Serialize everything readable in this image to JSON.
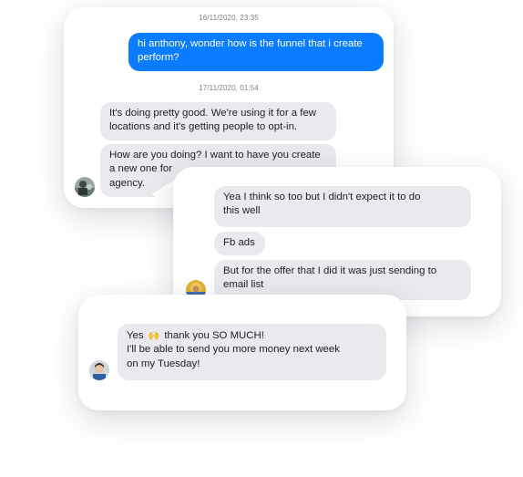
{
  "conversation_1": {
    "timestamp_1": "16/11/2020, 23:35",
    "outgoing": {
      "line1": "hi anthony, wonder how is the funnel that i create",
      "line2": "perform?"
    },
    "timestamp_2": "17/11/2020, 01:54",
    "reply_1": {
      "line1": "It's doing pretty good. We're using it for a few",
      "line2": "locations and it's getting people to opt-in."
    },
    "reply_2": {
      "line1": "How are you doing? I want to have you create",
      "line2": "a new one for",
      "line3": "agency."
    }
  },
  "conversation_2": {
    "msg_1": {
      "line1": "Yea I think so too but I didn't expect it to do",
      "line2": "this well"
    },
    "msg_2": "Fb ads",
    "msg_3": {
      "line1": "But for the offer that I did it was just sending to",
      "line2": "email list"
    }
  },
  "conversation_3": {
    "msg_1": {
      "line1a": "Yes",
      "line1b": "thank you SO MUCH!",
      "line2": "I'll be able to send you more money next week",
      "line3": "on my Tuesday!"
    },
    "emoji": "🙌"
  },
  "colors": {
    "outgoing_bubble": "#0a7cff",
    "incoming_bubble": "#e9eaed",
    "timestamp_text": "#7a7f87"
  }
}
